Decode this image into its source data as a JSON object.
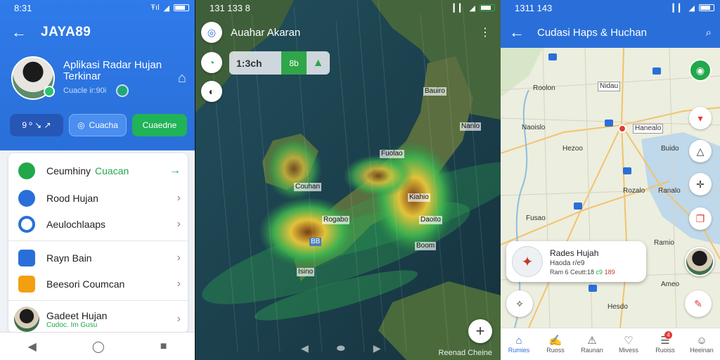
{
  "colors": {
    "primary": "#2a6fd9",
    "accent_green": "#22a84a",
    "radar_low": "#2fae4e",
    "radar_mid": "#e6d63a",
    "radar_high": "#8b4a1a"
  },
  "panel1": {
    "status": {
      "time": "8:31",
      "signal_text": "Ŧıl"
    },
    "appbar": {
      "title": "JAYA89"
    },
    "profile": {
      "name": "Aplikasi Radar Hujan Terkinar",
      "subtitle": "Cuacle ir:90i"
    },
    "chips": [
      "9 º ↘ ↗",
      "Cuacha",
      "Cuaedne"
    ],
    "menu": [
      {
        "label": "Ceumhiny",
        "label_accent": "Cuacan",
        "icon": "chat-icon"
      },
      {
        "label": "Rood Hujan",
        "icon": "radar-icon"
      },
      {
        "label": "Aeulochlaaps",
        "icon": "person-icon"
      },
      {
        "label": "Rayn Bain",
        "icon": "calendar-icon"
      },
      {
        "label": "Beesori Coumcan",
        "icon": "mail-icon"
      },
      {
        "label": "Gadeet Hujan",
        "sub": "Cudoc. Im Gusu",
        "icon": "avatar"
      }
    ]
  },
  "panel2": {
    "status": {
      "time": "131 133 8"
    },
    "appbar": {
      "title": "Auahar Akaran"
    },
    "timebar": {
      "time": "1:3ch",
      "badge": "8b"
    },
    "cities": [
      {
        "name": "Bauiro"
      },
      {
        "name": "Nanlo"
      },
      {
        "name": "Fuolao"
      },
      {
        "name": "Couhan"
      },
      {
        "name": "Kiahio"
      },
      {
        "name": "Rogabo"
      },
      {
        "name": "Daoito"
      },
      {
        "name": "Boom"
      },
      {
        "name": "Isino"
      },
      {
        "name": "BB"
      }
    ],
    "fab": "+",
    "credit": "Reenad Cheine"
  },
  "panel3": {
    "status": {
      "time": "1311 143"
    },
    "appbar": {
      "title": "Cudasi Haps & Huchan"
    },
    "labels": [
      {
        "name": "Roolon"
      },
      {
        "name": "Naoislo"
      },
      {
        "name": "Hanealo"
      },
      {
        "name": "Nidau"
      },
      {
        "name": "Hezoo"
      },
      {
        "name": "Buido"
      },
      {
        "name": "Rozalo"
      },
      {
        "name": "Ranalo"
      },
      {
        "name": "Fusao"
      },
      {
        "name": "Ramio"
      },
      {
        "name": "Hesdo"
      },
      {
        "name": "Ameo"
      }
    ],
    "info_card": {
      "title": "Rades Hujah",
      "line2": "Haoda r/e9",
      "line3_a": "Ram 6 Ceutt:18",
      "line3_b": "c9",
      "line3_c": "189"
    },
    "bottom_nav": [
      {
        "label": "Rumies",
        "icon": "home-icon",
        "active": true
      },
      {
        "label": "Ruoss",
        "icon": "edit-icon"
      },
      {
        "label": "Raunan",
        "icon": "warning-icon"
      },
      {
        "label": "Mivess",
        "icon": "heart-icon"
      },
      {
        "label": "Ruoiss",
        "icon": "list-icon",
        "badge": "4"
      },
      {
        "label": "Heeinan",
        "icon": "person-icon"
      }
    ]
  }
}
